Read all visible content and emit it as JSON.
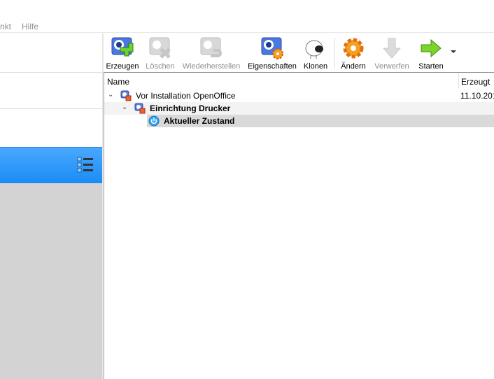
{
  "menu": {
    "items": [
      "nkt",
      "Hilfe"
    ]
  },
  "toolbar": {
    "create": "Erzeugen",
    "delete": "Löschen",
    "restore": "Wiederherstellen",
    "properties": "Eigenschaften",
    "clone": "Klonen",
    "settings": "Ändern",
    "discard": "Verwerfen",
    "start": "Starten"
  },
  "tree": {
    "columns": [
      "Name",
      "Erzeugt"
    ],
    "rows": [
      {
        "name": "Vor Installation OpenOffice",
        "date": "11.10.201"
      },
      {
        "name": "Einrichtung Drucker"
      },
      {
        "name": "Aktueller Zustand"
      }
    ]
  },
  "left": {
    "selected_cut": ")"
  },
  "colors": {
    "selection": "#1a8cf5",
    "grey": "#d3d3d3"
  }
}
